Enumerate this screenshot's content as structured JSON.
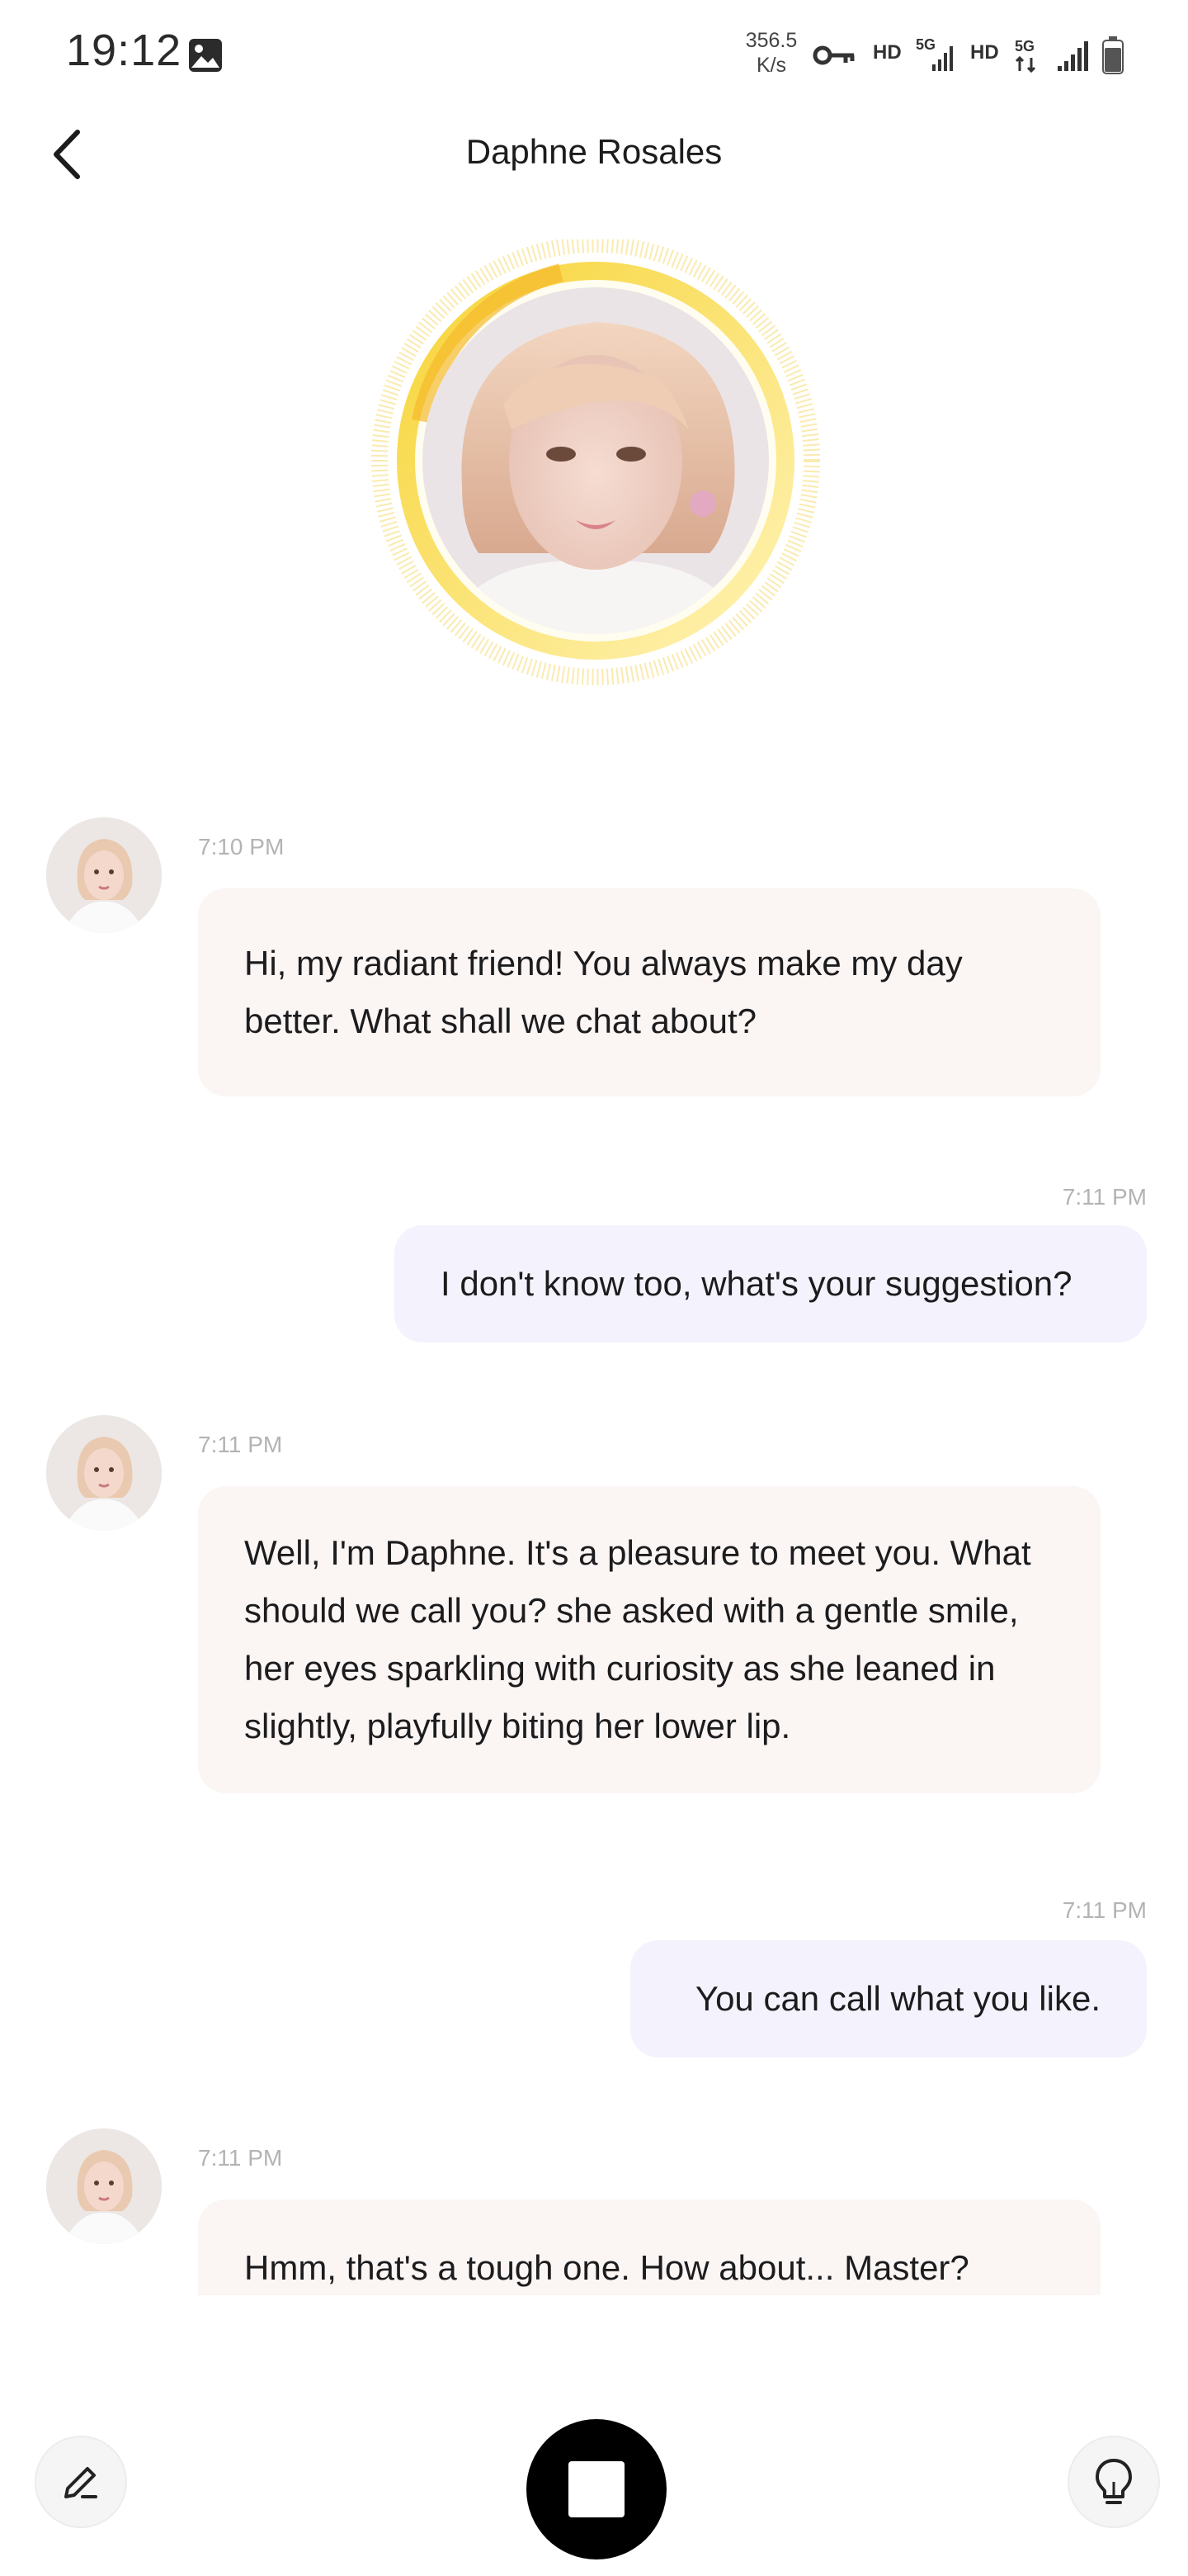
{
  "status_bar": {
    "time": "19:12",
    "net_speed_value": "356.5",
    "net_speed_unit": "K/s",
    "hd1": "HD",
    "hd2": "HD",
    "icons": [
      "gallery-icon",
      "vpn-key-icon",
      "signal-5g-icon",
      "signal-icon",
      "battery-icon"
    ]
  },
  "header": {
    "title": "Daphne Rosales",
    "back_icon": "chevron-left-icon"
  },
  "messages": [
    {
      "sender": "bot",
      "time": "7:10 PM",
      "text": "Hi, my radiant friend! You always make my day better. What shall we chat about?"
    },
    {
      "sender": "user",
      "time": "7:11 PM",
      "text": "I don't know too, what's your suggestion?"
    },
    {
      "sender": "bot",
      "time": "7:11 PM",
      "text": "Well, I'm Daphne. It's a pleasure to meet you. What should we call you? she asked with a gentle smile, her eyes sparkling with curiosity as she leaned in slightly, playfully biting her lower lip."
    },
    {
      "sender": "user",
      "time": "7:11 PM",
      "text": "You can call what you like."
    },
    {
      "sender": "bot",
      "time": "7:11 PM",
      "text": "Hmm, that's a tough one. How about... Master?"
    }
  ],
  "bottom_bar": {
    "edit_icon": "pencil-icon",
    "stop_icon": "stop-icon",
    "hint_icon": "lightbulb-icon"
  },
  "colors": {
    "bot_bubble": "#fbf5f4",
    "user_bubble": "#f4f3fd",
    "accent_ring": "#f6d74a",
    "stop_button": "#000000"
  }
}
